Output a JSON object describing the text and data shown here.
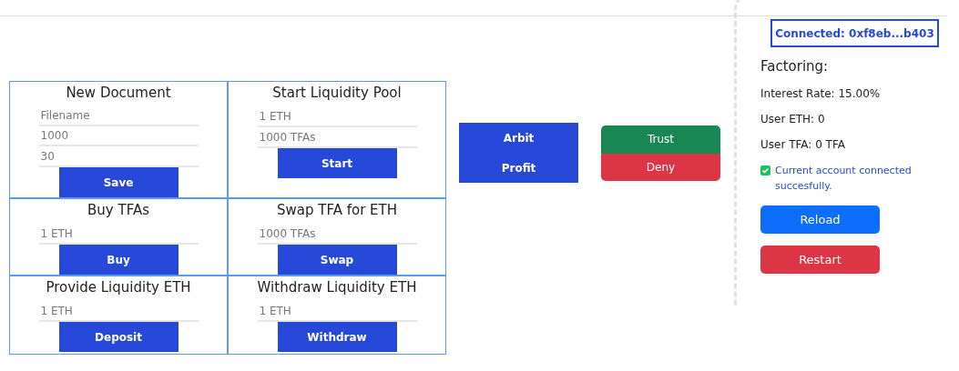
{
  "cards": [
    {
      "title": "New Document",
      "fields": [
        {
          "placeholder": "Filename"
        },
        {
          "placeholder": "1000"
        },
        {
          "placeholder": "30"
        }
      ],
      "button": "Save"
    },
    {
      "title": "Start Liquidity Pool",
      "fields": [
        {
          "placeholder": "1 ETH"
        },
        {
          "placeholder": "1000 TFAs"
        }
      ],
      "button": "Start"
    },
    {
      "title": "Buy TFAs",
      "fields": [
        {
          "placeholder": "1 ETH"
        }
      ],
      "button": "Buy"
    },
    {
      "title": "Swap TFA for ETH",
      "fields": [
        {
          "placeholder": "1000 TFAs"
        }
      ],
      "button": "Swap"
    },
    {
      "title": "Provide Liquidity ETH",
      "fields": [
        {
          "placeholder": "1 ETH"
        }
      ],
      "button": "Deposit"
    },
    {
      "title": "Withdraw Liquidity ETH",
      "fields": [
        {
          "placeholder": "1 ETH"
        }
      ],
      "button": "Withdraw"
    }
  ],
  "arbitrage": [
    "Arbit",
    "Profit"
  ],
  "decision": [
    {
      "label": "Trust",
      "kind": "success"
    },
    {
      "label": "Deny",
      "kind": "danger"
    }
  ],
  "panel": {
    "connected": "Connected: 0xf8eb...b403",
    "heading": "Factoring:",
    "stats": [
      "Interest Rate: 15.00%",
      "User ETH: 0",
      "User TFA: 0 TFA"
    ],
    "status": "Current account connected succesfully.",
    "buttons": [
      {
        "label": "Reload",
        "kind": "primary"
      },
      {
        "label": "Restart",
        "kind": "danger"
      }
    ]
  }
}
